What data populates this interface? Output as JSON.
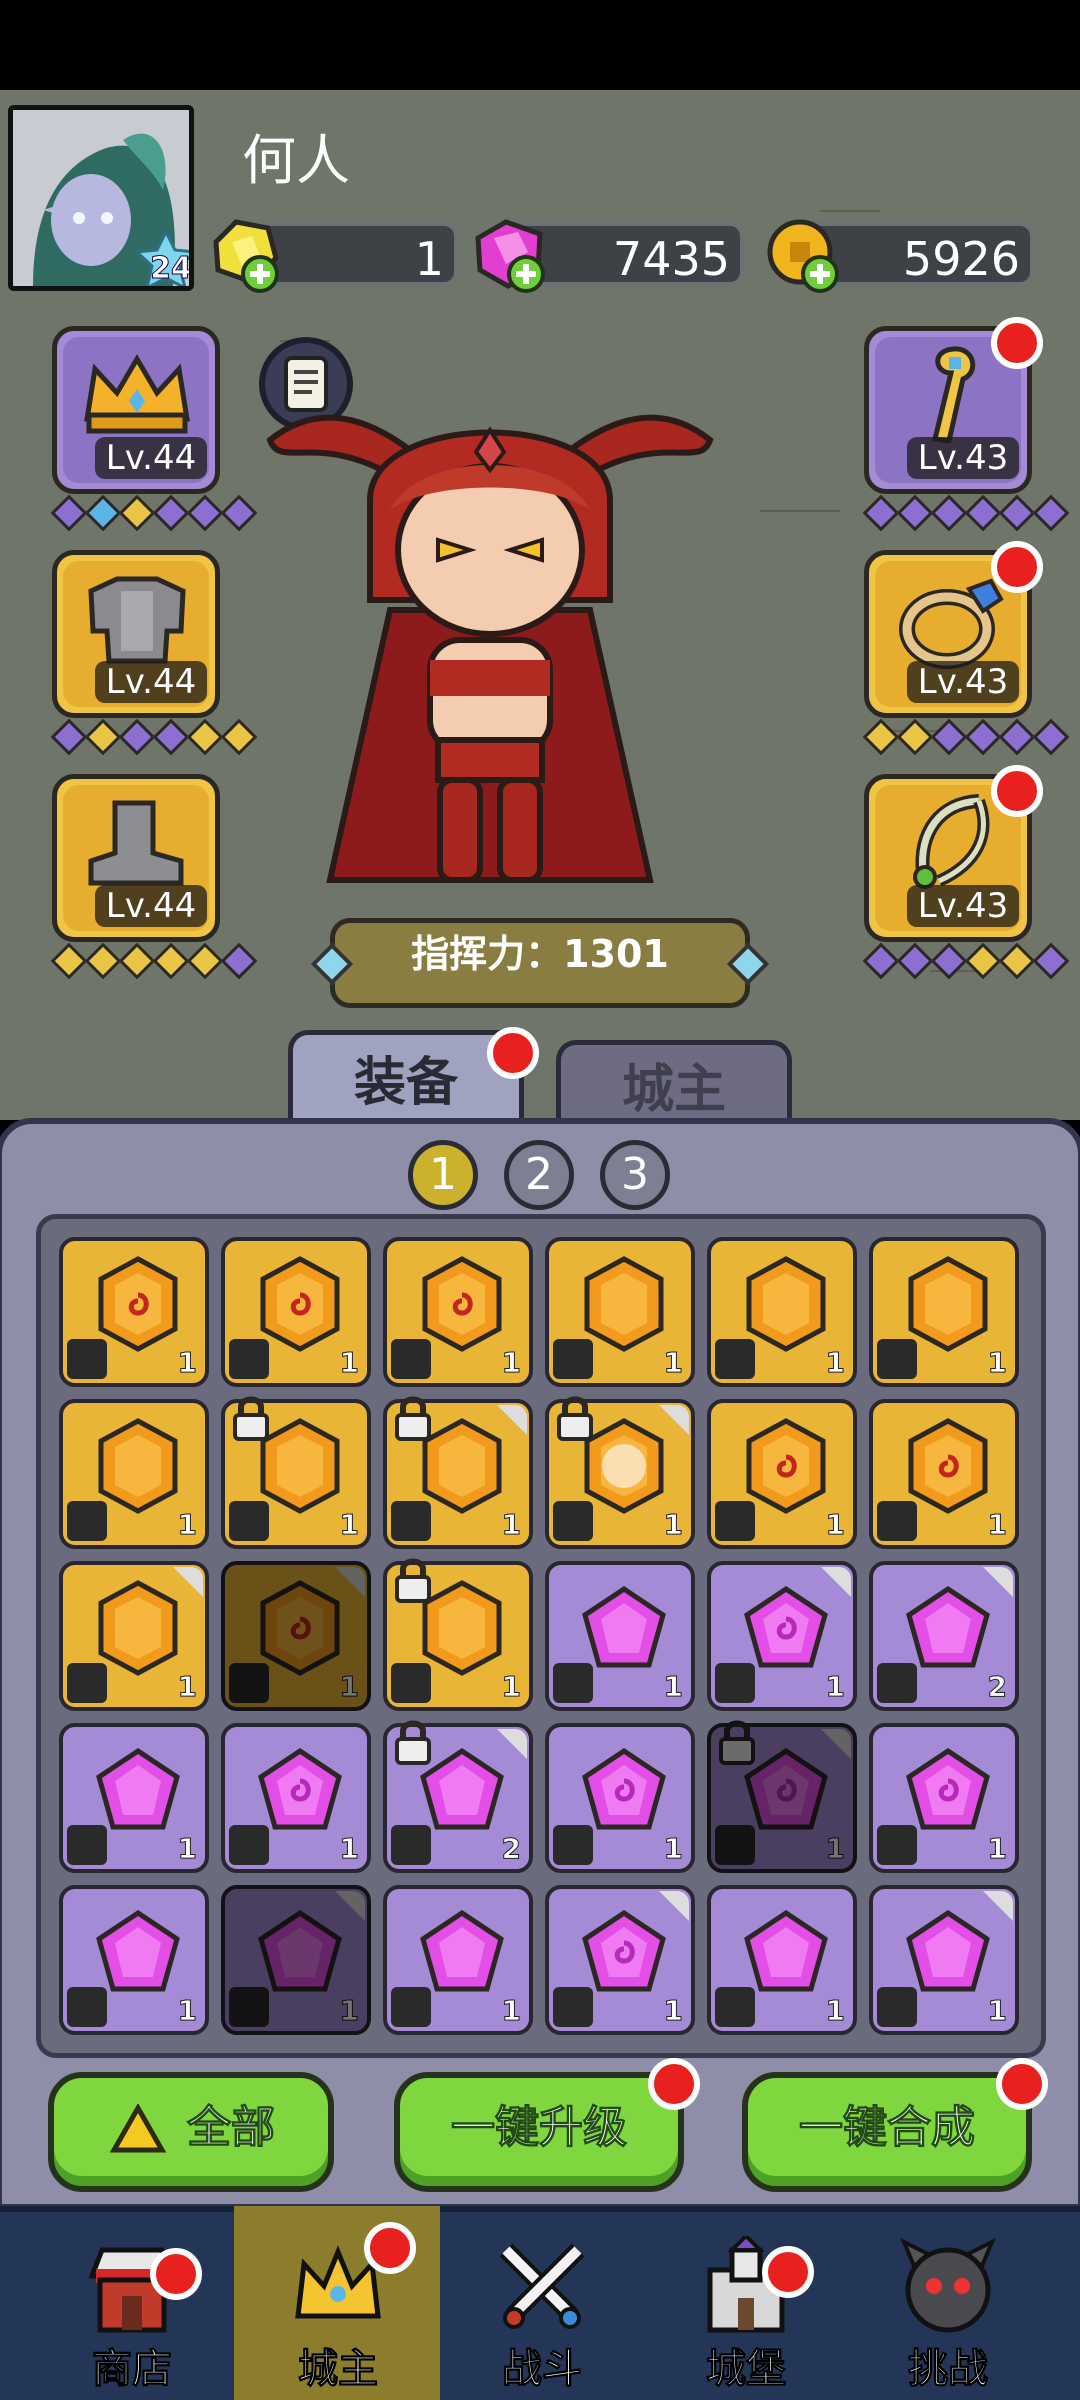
{
  "player": {
    "name": "何人",
    "level": "24"
  },
  "resources": [
    {
      "id": "gold-gem",
      "value": "1",
      "color": "#f1e03b"
    },
    {
      "id": "pink-gem",
      "value": "7435",
      "color": "#e23fd1"
    },
    {
      "id": "coin",
      "value": "5926",
      "color": "#f0b51c"
    }
  ],
  "equipment": {
    "left": [
      {
        "item": "crown",
        "level": "Lv.44",
        "rarity": "purple",
        "diamonds": [
          "#8c6fd1",
          "#5bb4e6",
          "#e8c545",
          "#8c6fd1",
          "#8c6fd1",
          "#8c6fd1"
        ]
      },
      {
        "item": "chest-armor",
        "level": "Lv.44",
        "rarity": "gold",
        "diamonds": [
          "#8c6fd1",
          "#e8c545",
          "#8c6fd1",
          "#8c6fd1",
          "#e8c545",
          "#e8c545"
        ]
      },
      {
        "item": "boots",
        "level": "Lv.44",
        "rarity": "gold",
        "diamonds": [
          "#e8c545",
          "#e8c545",
          "#e8c545",
          "#e8c545",
          "#e8c545",
          "#8c6fd1"
        ]
      }
    ],
    "right": [
      {
        "item": "staff",
        "level": "Lv.43",
        "rarity": "purple",
        "diamonds": [
          "#8c6fd1",
          "#8c6fd1",
          "#8c6fd1",
          "#8c6fd1",
          "#8c6fd1",
          "#8c6fd1"
        ]
      },
      {
        "item": "ring",
        "level": "Lv.43",
        "rarity": "gold",
        "diamonds": [
          "#e8c545",
          "#e8c545",
          "#8c6fd1",
          "#8c6fd1",
          "#8c6fd1",
          "#8c6fd1"
        ]
      },
      {
        "item": "amulet",
        "level": "Lv.43",
        "rarity": "gold",
        "diamonds": [
          "#8c6fd1",
          "#8c6fd1",
          "#8c6fd1",
          "#e8c545",
          "#e8c545",
          "#8c6fd1"
        ]
      }
    ]
  },
  "hero": {
    "name_hidden": "",
    "command_power": "指挥力：1301"
  },
  "tabs": [
    {
      "label": "装备",
      "active": true
    },
    {
      "label": "城主",
      "active": false
    }
  ],
  "pages": [
    "1",
    "2",
    "3"
  ],
  "inventory": [
    {
      "rarity": "gold",
      "swirl": true,
      "slot": "crown",
      "count": "1"
    },
    {
      "rarity": "gold",
      "swirl": true,
      "slot": "crown",
      "count": "1"
    },
    {
      "rarity": "gold",
      "swirl": true,
      "slot": "crown",
      "count": "1"
    },
    {
      "rarity": "gold",
      "swirl": false,
      "slot": "armor",
      "count": "1"
    },
    {
      "rarity": "gold",
      "swirl": false,
      "slot": "armor",
      "count": "1"
    },
    {
      "rarity": "gold",
      "swirl": false,
      "slot": "boots",
      "count": "1"
    },
    {
      "rarity": "gold",
      "swirl": false,
      "slot": "staff",
      "count": "1"
    },
    {
      "rarity": "gold",
      "swirl": false,
      "slot": "staff",
      "count": "1",
      "locked": true
    },
    {
      "rarity": "gold",
      "swirl": false,
      "slot": "staff",
      "count": "1",
      "locked": true,
      "corner": true
    },
    {
      "rarity": "gold",
      "swirl": false,
      "slot": "staff",
      "count": "1",
      "locked": true,
      "corner": true,
      "glow": true
    },
    {
      "rarity": "gold",
      "swirl": true,
      "slot": "staff",
      "count": "1"
    },
    {
      "rarity": "gold",
      "swirl": true,
      "slot": "ring",
      "count": "1"
    },
    {
      "rarity": "gold",
      "swirl": false,
      "slot": "ring",
      "count": "1",
      "corner": true
    },
    {
      "rarity": "gold",
      "swirl": true,
      "slot": "ring",
      "count": "1",
      "corner": true,
      "dim": true
    },
    {
      "rarity": "gold",
      "swirl": false,
      "slot": "amulet",
      "count": "1",
      "locked": true
    },
    {
      "rarity": "purple",
      "swirl": false,
      "slot": "crown",
      "count": "1"
    },
    {
      "rarity": "purple",
      "swirl": true,
      "slot": "crown",
      "count": "1",
      "corner": true
    },
    {
      "rarity": "purple",
      "swirl": false,
      "slot": "armor",
      "count": "2",
      "corner": true
    },
    {
      "rarity": "purple",
      "swirl": false,
      "slot": "armor",
      "count": "1"
    },
    {
      "rarity": "purple",
      "swirl": true,
      "slot": "armor",
      "count": "1"
    },
    {
      "rarity": "purple",
      "swirl": false,
      "slot": "boots",
      "count": "2",
      "locked": true,
      "corner": true
    },
    {
      "rarity": "purple",
      "swirl": true,
      "slot": "boots",
      "count": "1"
    },
    {
      "rarity": "purple",
      "swirl": true,
      "slot": "staff",
      "count": "1",
      "locked": true,
      "corner": true,
      "dim": true
    },
    {
      "rarity": "purple",
      "swirl": true,
      "slot": "staff",
      "count": "1"
    },
    {
      "rarity": "purple",
      "swirl": false,
      "slot": "ring",
      "count": "1"
    },
    {
      "rarity": "purple",
      "swirl": false,
      "slot": "ring",
      "count": "1",
      "corner": true,
      "dim": true
    },
    {
      "rarity": "purple",
      "swirl": false,
      "slot": "ring",
      "count": "1"
    },
    {
      "rarity": "purple",
      "swirl": true,
      "slot": "ring",
      "count": "1",
      "corner": true
    },
    {
      "rarity": "purple",
      "swirl": false,
      "slot": "amulet",
      "count": "1"
    },
    {
      "rarity": "purple",
      "swirl": false,
      "slot": "amulet",
      "count": "1",
      "corner": true
    }
  ],
  "actions": [
    {
      "label": "全部",
      "icon": "triangle-icon",
      "badge": false
    },
    {
      "label": "一键升级",
      "badge": true
    },
    {
      "label": "一键合成",
      "badge": true
    }
  ],
  "nav": [
    {
      "label": "商店",
      "icon": "shop-icon",
      "badge": true
    },
    {
      "label": "城主",
      "icon": "crown-icon",
      "badge": true,
      "selected": true
    },
    {
      "label": "战斗",
      "icon": "swords-icon",
      "badge": false
    },
    {
      "label": "城堡",
      "icon": "castle-icon",
      "badge": true
    },
    {
      "label": "挑战",
      "icon": "demon-icon",
      "badge": false
    }
  ]
}
